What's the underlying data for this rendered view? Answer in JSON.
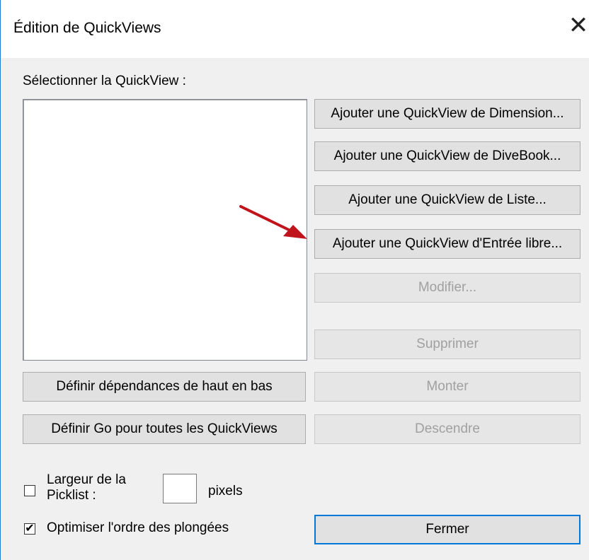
{
  "window": {
    "title": "Édition de QuickViews",
    "close_glyph": "✕"
  },
  "select_label": "Sélectionner la QuickView :",
  "buttons": {
    "add_dimension": "Ajouter une QuickView de Dimension...",
    "add_divebook": "Ajouter une QuickView de DiveBook...",
    "add_list": "Ajouter une QuickView de Liste...",
    "add_free_entry": "Ajouter une QuickView d'Entrée libre...",
    "modify": "Modifier...",
    "delete": "Supprimer",
    "define_dependencies": "Définir dépendances de haut en bas",
    "move_up": "Monter",
    "define_go": "Définir Go pour toutes les QuickViews",
    "move_down": "Descendre",
    "close": "Fermer"
  },
  "picklist": {
    "label_line1": "Largeur de la",
    "label_line2": "Picklist :",
    "value": "",
    "unit": "pixels",
    "checked": false
  },
  "optimize": {
    "label": "Optimiser l'ordre des plongées",
    "checked": true,
    "check_glyph": "✔"
  },
  "annotation": {
    "arrow_color": "#c0141c"
  }
}
